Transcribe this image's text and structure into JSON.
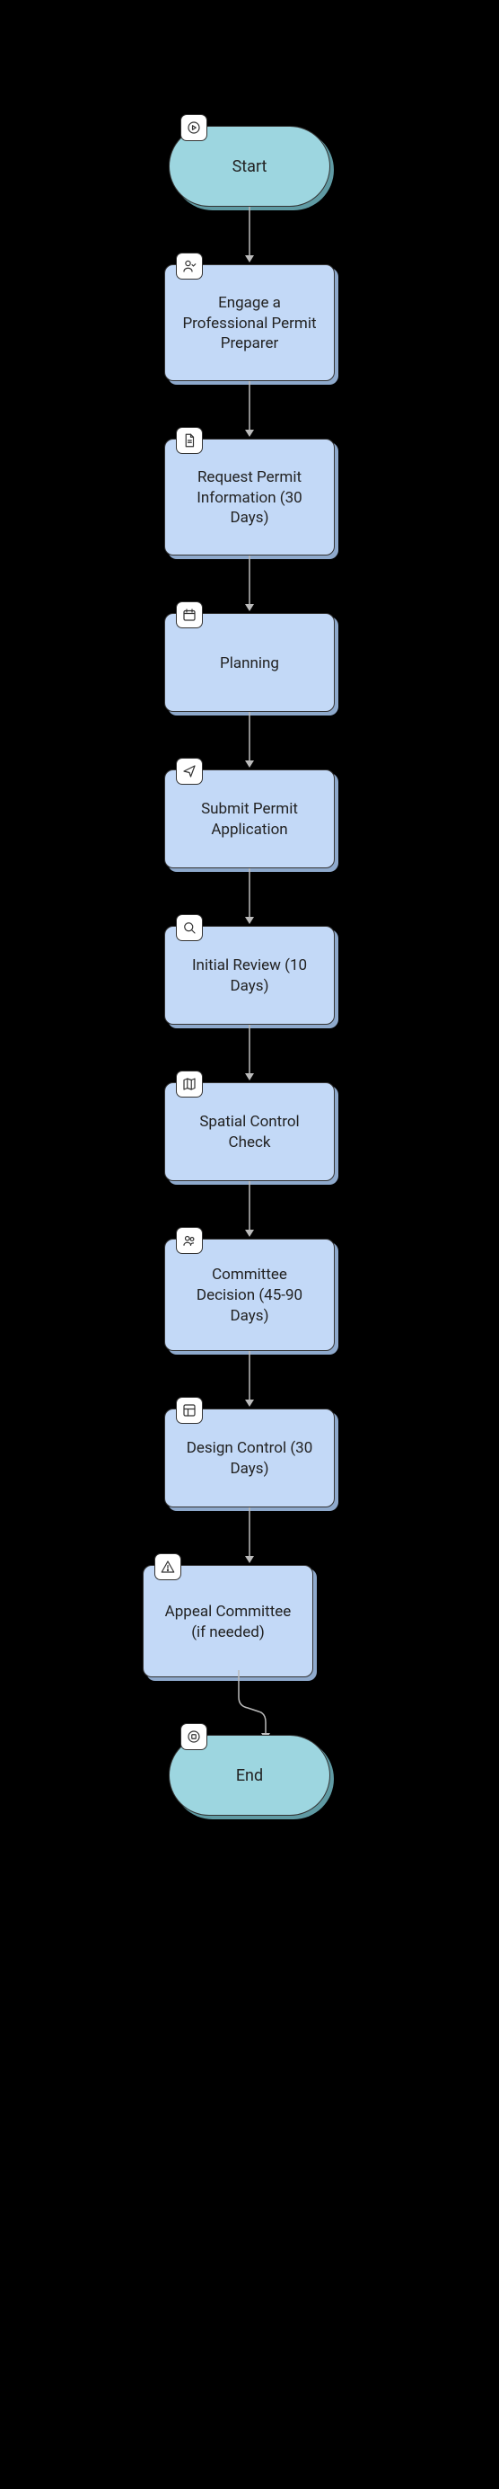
{
  "flow": {
    "start": {
      "label": "Start"
    },
    "engage": {
      "label": "Engage a Professional Permit Preparer"
    },
    "request_info": {
      "label": "Request Permit Information (30 Days)"
    },
    "planning": {
      "label": "Planning"
    },
    "submit": {
      "label": "Submit Permit Application"
    },
    "initial_review": {
      "label": "Initial Review (10 Days)"
    },
    "spatial_check": {
      "label": "Spatial Control Check"
    },
    "committee": {
      "label": "Committee Decision (45-90 Days)"
    },
    "design_control": {
      "label": "Design Control (30 Days)"
    },
    "appeal": {
      "label": "Appeal Committee (if needed)"
    },
    "end": {
      "label": "End"
    }
  },
  "colors": {
    "terminator_bg": "#9dd6e0",
    "process_bg": "#c3d9f7",
    "background": "#000000"
  }
}
